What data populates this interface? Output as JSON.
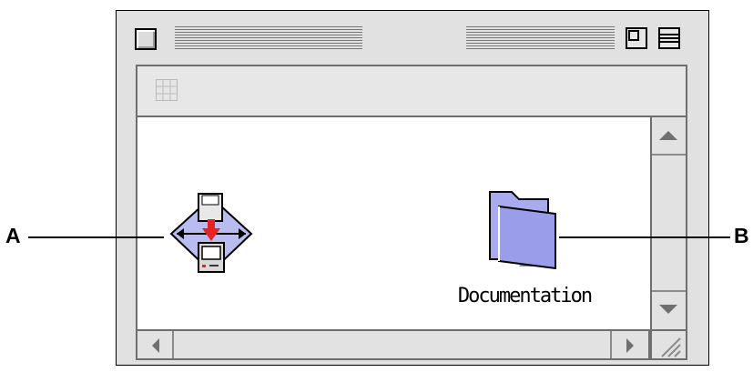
{
  "window": {
    "title": "",
    "controls": {
      "close": "close-box",
      "zoom": "zoom-box",
      "collapse": "collapse-box"
    },
    "header": {
      "view_icon": "grid-view-icon"
    },
    "scrollbars": {
      "vertical": [
        "up-arrow-icon",
        "down-arrow-icon"
      ],
      "horizontal": [
        "left-arrow-icon",
        "right-arrow-icon"
      ],
      "resize": "grow-box-icon"
    }
  },
  "items": [
    {
      "name": "",
      "icon": "installer-icon",
      "callout": "A"
    },
    {
      "name": "Documentation",
      "icon": "folder-icon",
      "callout": "B"
    }
  ],
  "colors": {
    "window_bg": "#e1e1e1",
    "content_bg": "#ffffff",
    "folder": "#a8acef",
    "installer_arrow": "#e52421"
  }
}
